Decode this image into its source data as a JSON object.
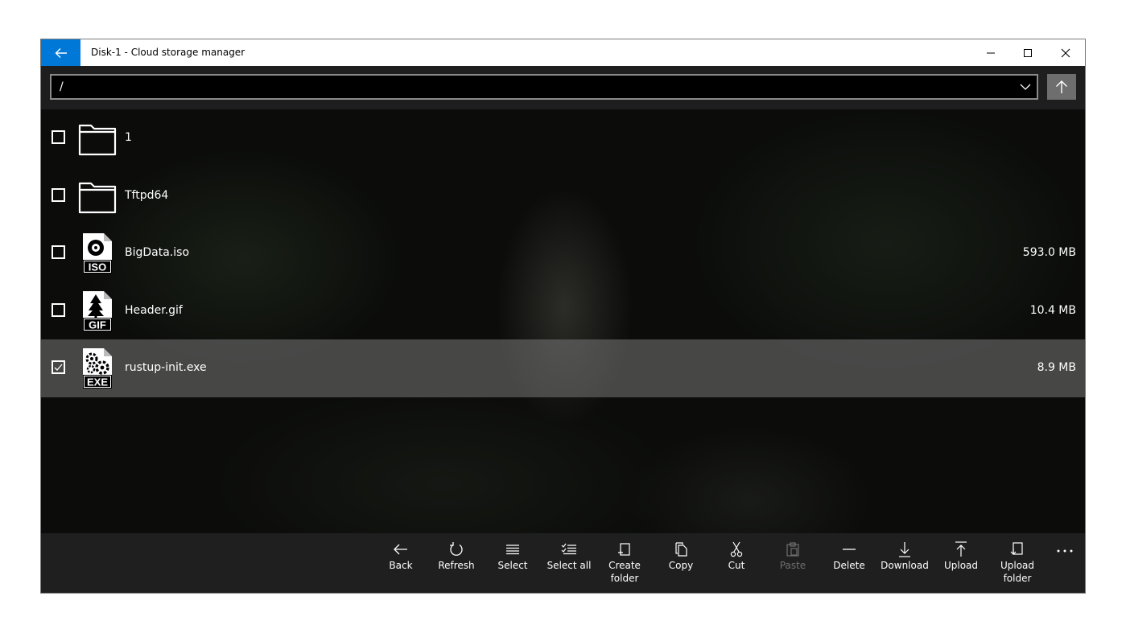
{
  "window": {
    "title": "Disk-1 - Cloud storage manager",
    "accent_color": "#0078d7"
  },
  "pathbar": {
    "path": "/"
  },
  "files": [
    {
      "name": "1",
      "size": "",
      "type": "folder",
      "checked": false
    },
    {
      "name": "Tftpd64",
      "size": "",
      "type": "folder",
      "checked": false
    },
    {
      "name": "BigData.iso",
      "size": "593.0 MB",
      "type": "ISO",
      "checked": false
    },
    {
      "name": "Header.gif",
      "size": "10.4 MB",
      "type": "GIF",
      "checked": false
    },
    {
      "name": "rustup-init.exe",
      "size": "8.9 MB",
      "type": "EXE",
      "checked": true
    }
  ],
  "commands": {
    "back": "Back",
    "refresh": "Refresh",
    "select": "Select",
    "select_all": "Select all",
    "create_folder": "Create folder",
    "copy": "Copy",
    "cut": "Cut",
    "paste": "Paste",
    "delete": "Delete",
    "download": "Download",
    "upload": "Upload",
    "upload_folder": "Upload folder"
  }
}
